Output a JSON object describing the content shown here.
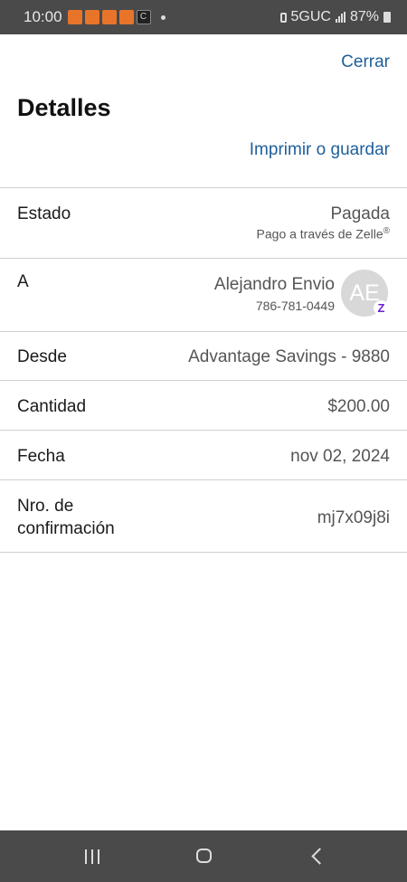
{
  "status_bar": {
    "time": "10:00",
    "network": "5GUC",
    "battery": "87%",
    "notification_icons": [
      "news-app-icon",
      "news-app-icon",
      "news-app-icon",
      "news-app-icon",
      "c-app-icon"
    ],
    "notification_c": "C"
  },
  "header": {
    "close_label": "Cerrar",
    "title": "Detalles",
    "print_label": "Imprimir o guardar"
  },
  "details": {
    "estado_label": "Estado",
    "estado_value": "Pagada",
    "estado_sub": "Pago a través de Zelle",
    "estado_sub_mark": "®",
    "a_label": "A",
    "recipient_name": "Alejandro Envio",
    "recipient_phone": "786-781-0449",
    "avatar_initials": "AE",
    "zelle_mark": "Z",
    "desde_label": "Desde",
    "desde_value": "Advantage Savings - 9880",
    "cantidad_label": "Cantidad",
    "cantidad_value": "$200.00",
    "fecha_label": "Fecha",
    "fecha_value": "nov 02, 2024",
    "confirm_label_1": "Nro. de",
    "confirm_label_2": "confirmación",
    "confirm_value": "mj7x09j8i"
  },
  "colors": {
    "link": "#1f5f9a",
    "zelle": "#6d1ed4",
    "system_bar": "#4a4a4a"
  }
}
